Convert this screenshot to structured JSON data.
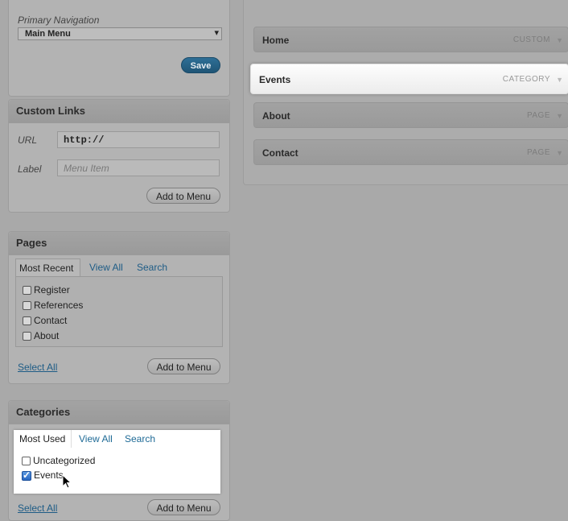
{
  "nav": {
    "heading": "Primary Navigation",
    "menu_select_value": "Main Menu",
    "save_label": "Save"
  },
  "custom_links": {
    "title": "Custom Links",
    "url_label": "URL",
    "url_value": "http://",
    "label_label": "Label",
    "label_placeholder": "Menu Item",
    "add_label": "Add to Menu"
  },
  "pages": {
    "title": "Pages",
    "tabs": [
      "Most Recent",
      "View All",
      "Search"
    ],
    "items": [
      "Register",
      "References",
      "Contact",
      "About"
    ],
    "select_all": "Select All",
    "add_label": "Add to Menu"
  },
  "categories": {
    "title": "Categories",
    "tabs": [
      "Most Used",
      "View All",
      "Search"
    ],
    "items": [
      {
        "label": "Uncategorized",
        "checked": false
      },
      {
        "label": "Events",
        "checked": true
      }
    ],
    "select_all": "Select All",
    "add_label": "Add to Menu"
  },
  "menu_items": [
    {
      "label": "Home",
      "type": "CUSTOM"
    },
    {
      "label": "Events",
      "type": "CATEGORY"
    },
    {
      "label": "About",
      "type": "PAGE"
    },
    {
      "label": "Contact",
      "type": "PAGE"
    }
  ]
}
